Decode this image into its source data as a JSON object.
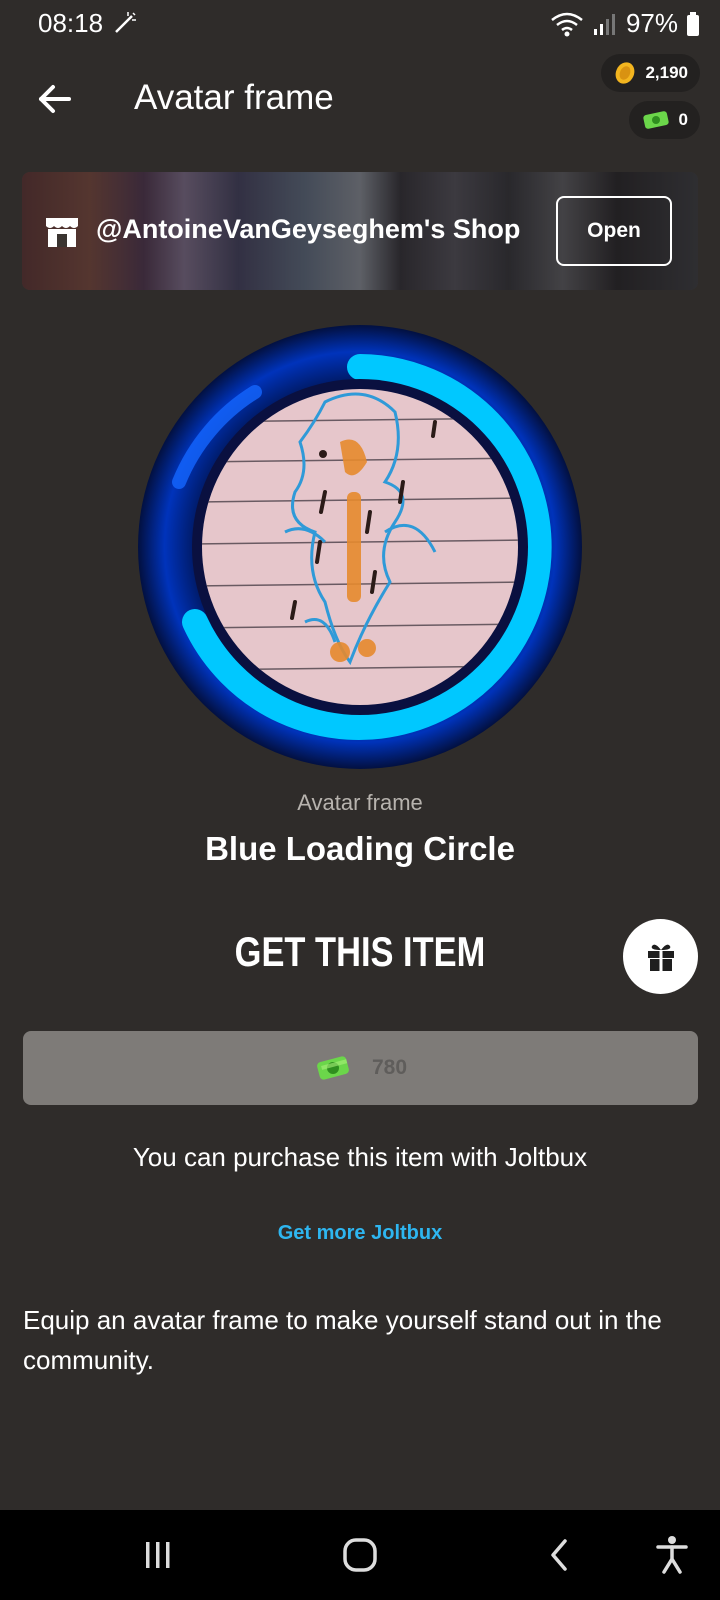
{
  "status_bar": {
    "time": "08:18",
    "battery": "97%"
  },
  "header": {
    "title": "Avatar frame",
    "coins": "2,190",
    "joltbux": "0"
  },
  "shop": {
    "name": "@AntoineVanGeyseghem's Shop",
    "open_label": "Open"
  },
  "item": {
    "type_label": "Avatar frame",
    "name": "Blue Loading Circle"
  },
  "purchase": {
    "heading": "GET THIS ITEM",
    "price": "780",
    "note": "You can purchase this item with Joltbux",
    "get_more_label": "Get more Joltbux"
  },
  "description": "Equip an avatar frame to make yourself stand out in the community.",
  "colors": {
    "background": "#2f2c2a",
    "accent_link": "#2eb6f0",
    "frame_ring": "#00b8ff",
    "price_button": "#7e7b78"
  }
}
